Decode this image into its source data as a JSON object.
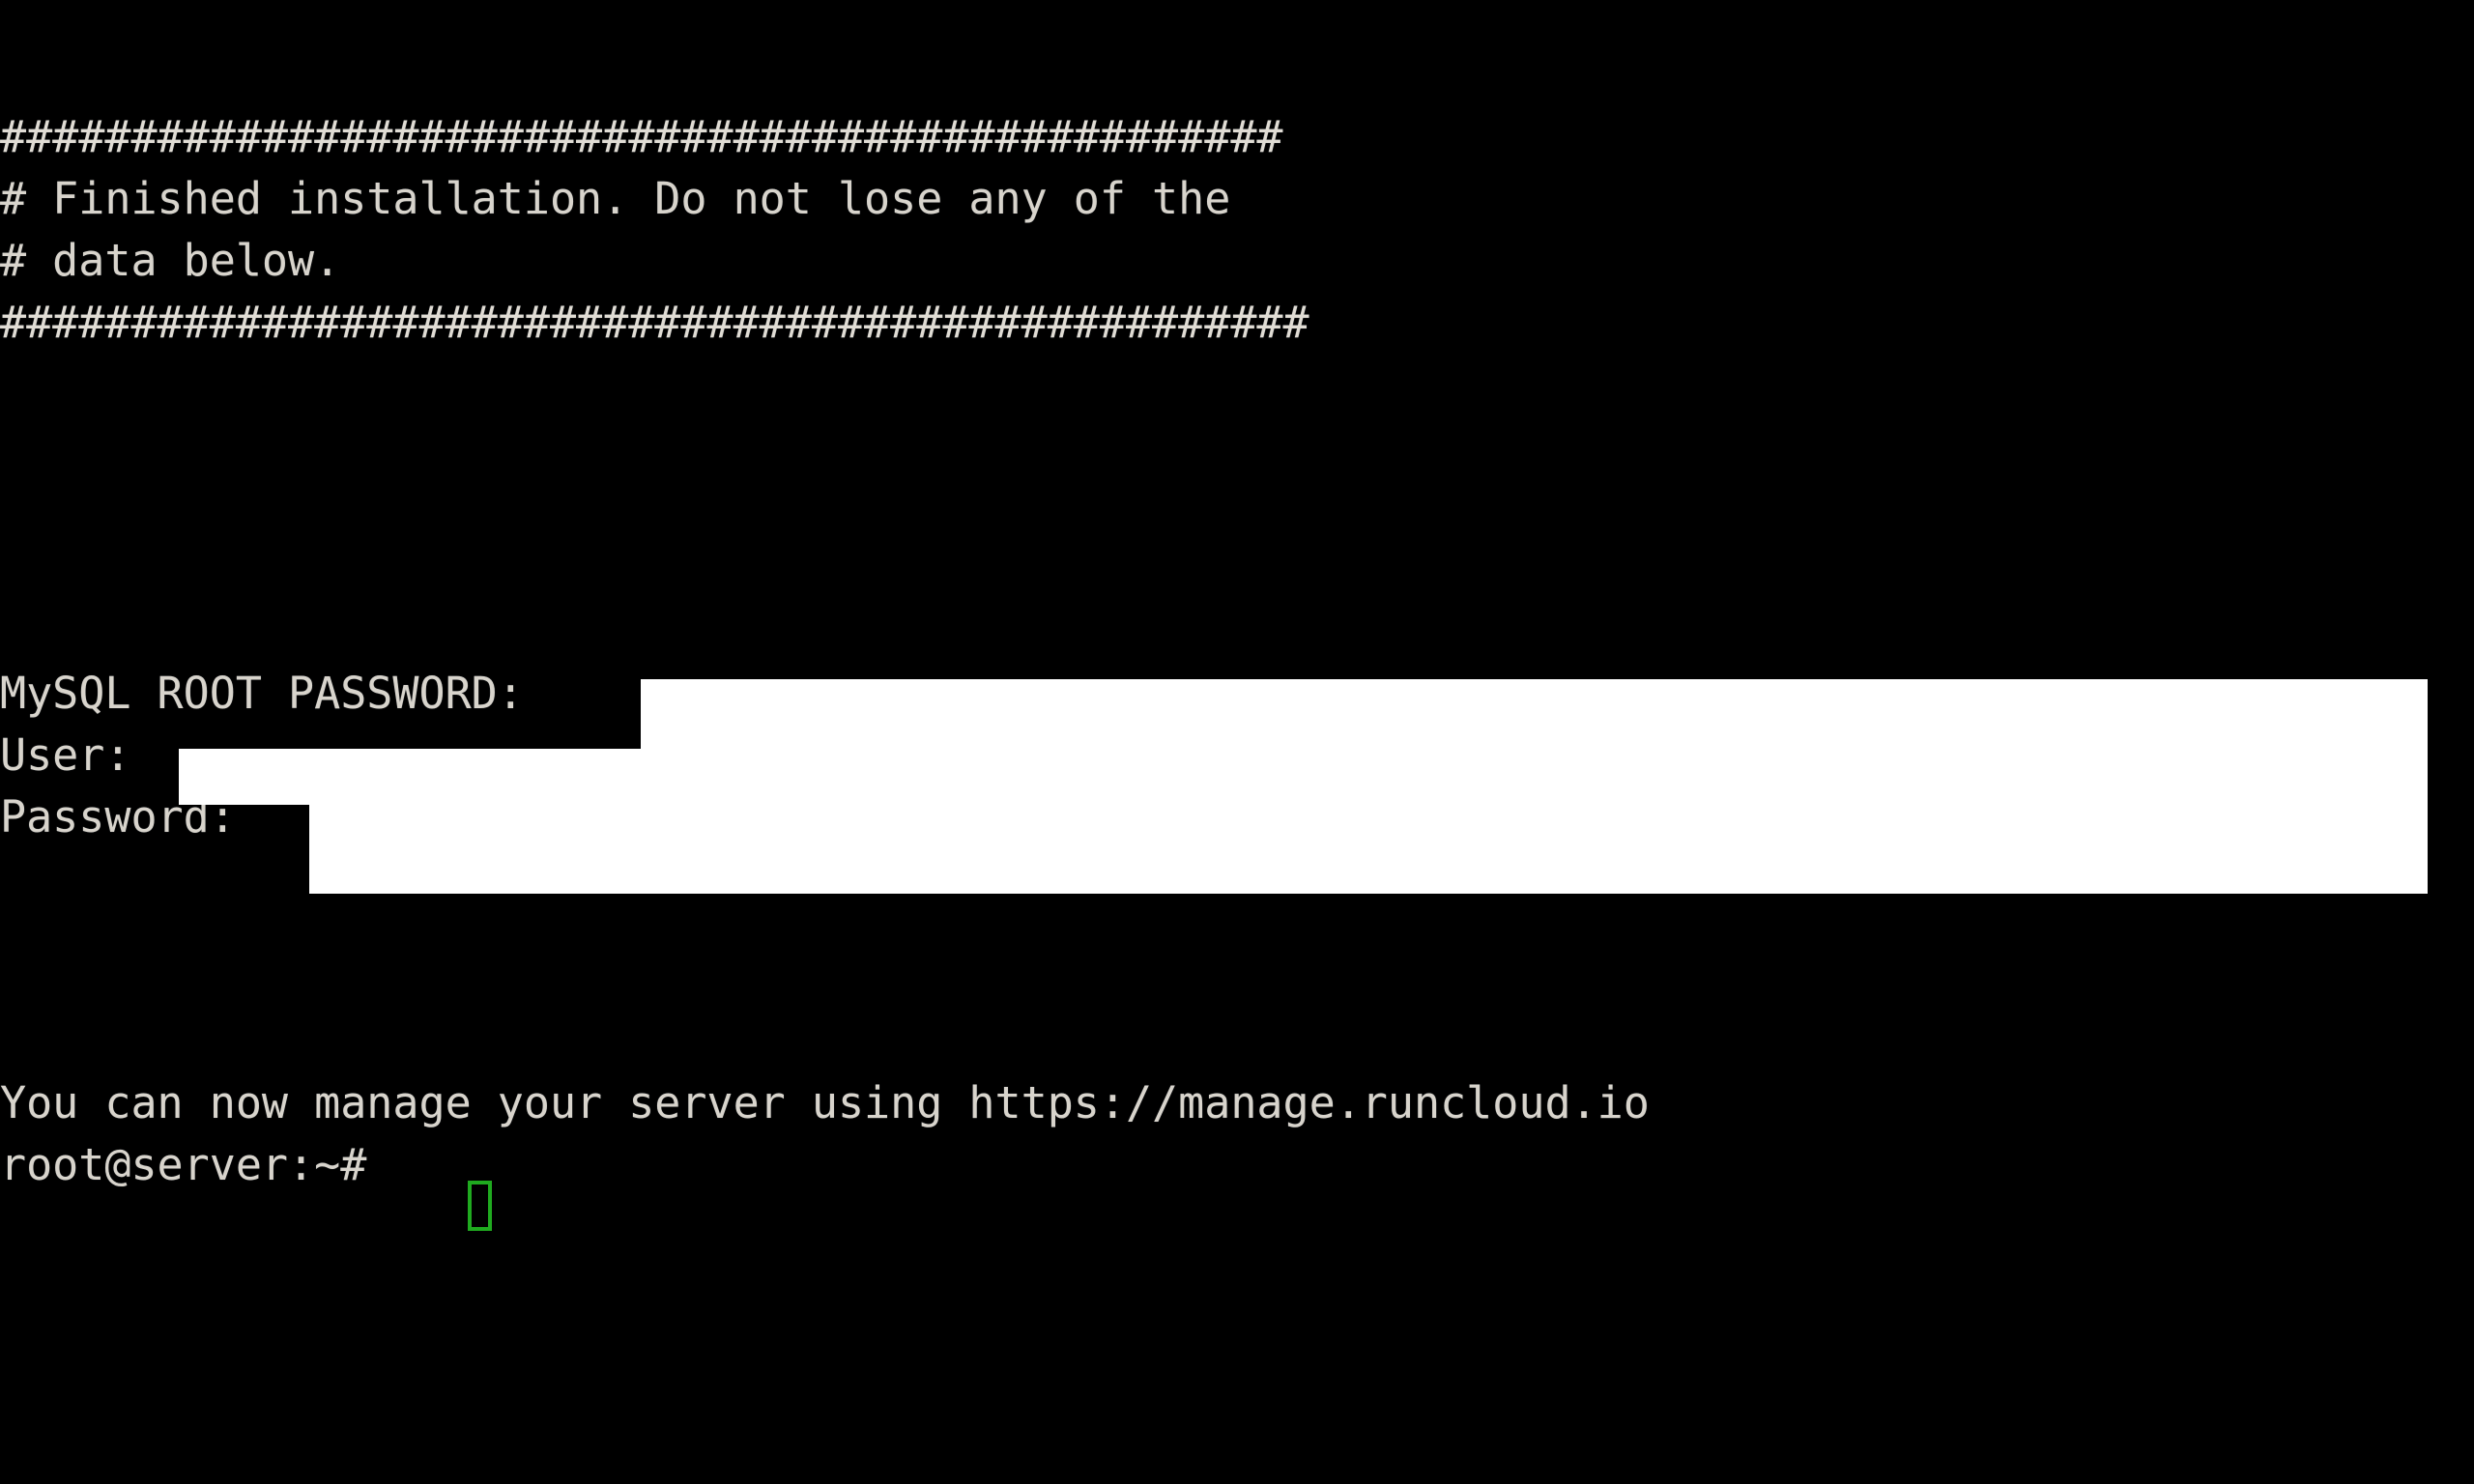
{
  "terminal": {
    "background_color": "#000000",
    "foreground_color": "#d8d4cc",
    "cursor_color": "#1faa1f",
    "redaction_color": "#ffffff",
    "banner": {
      "rule_top": "#################################################",
      "line_1": "# Finished installation. Do not lose any of the",
      "line_2": "# data below.",
      "rule_bottom": "##################################################"
    },
    "credentials": {
      "mysql_root_label": "MySQL ROOT PASSWORD:",
      "mysql_root_value": "",
      "user_label": "User:",
      "user_value": "",
      "password_label": "Password:",
      "password_value": ""
    },
    "footer": {
      "manage_message": "You can now manage your server using https://manage.runcloud.io",
      "manage_url": "https://manage.runcloud.io"
    },
    "prompt": {
      "text": "root@server:~# ",
      "user": "root",
      "host": "server",
      "path": "~",
      "symbol": "#",
      "input_value": ""
    }
  }
}
